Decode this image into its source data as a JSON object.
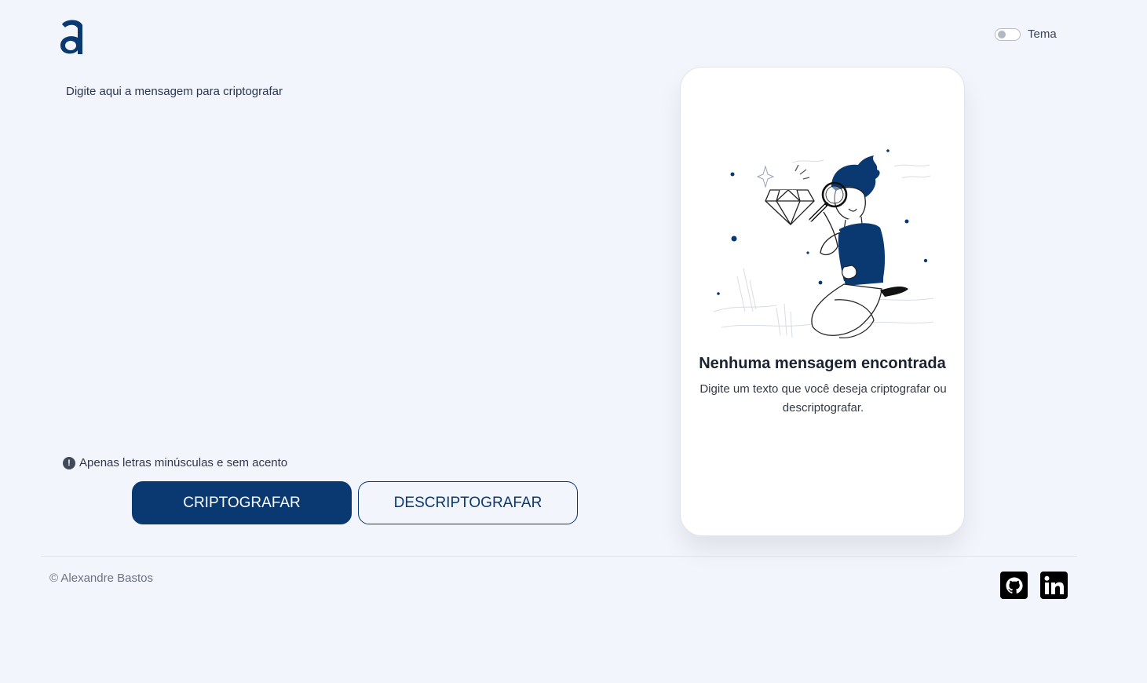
{
  "header": {
    "logo_icon": "alura-a-logo-icon",
    "theme_toggle": {
      "label": "Tema",
      "checked": false
    }
  },
  "input": {
    "placeholder": "Digite aqui a mensagem para criptografar",
    "value": ""
  },
  "hint": {
    "icon": "exclamation-circle-icon",
    "text": "Apenas letras minúsculas e sem acento"
  },
  "actions": {
    "encrypt_label": "CRIPTOGRAFAR",
    "decrypt_label": "DESCRIPTOGRAFAR"
  },
  "output": {
    "illustration": "person-with-magnifier-diamond-illustration",
    "empty_title": "Nenhuma mensagem encontrada",
    "empty_description": "Digite um texto que você deseja criptografar ou descriptografar."
  },
  "footer": {
    "copyright": "© Alexandre Bastos",
    "social": [
      {
        "icon": "github-icon"
      },
      {
        "icon": "linkedin-icon"
      }
    ]
  },
  "colors": {
    "background": "#f2f5fc",
    "primary": "#0a3871",
    "card": "#ffffff"
  }
}
